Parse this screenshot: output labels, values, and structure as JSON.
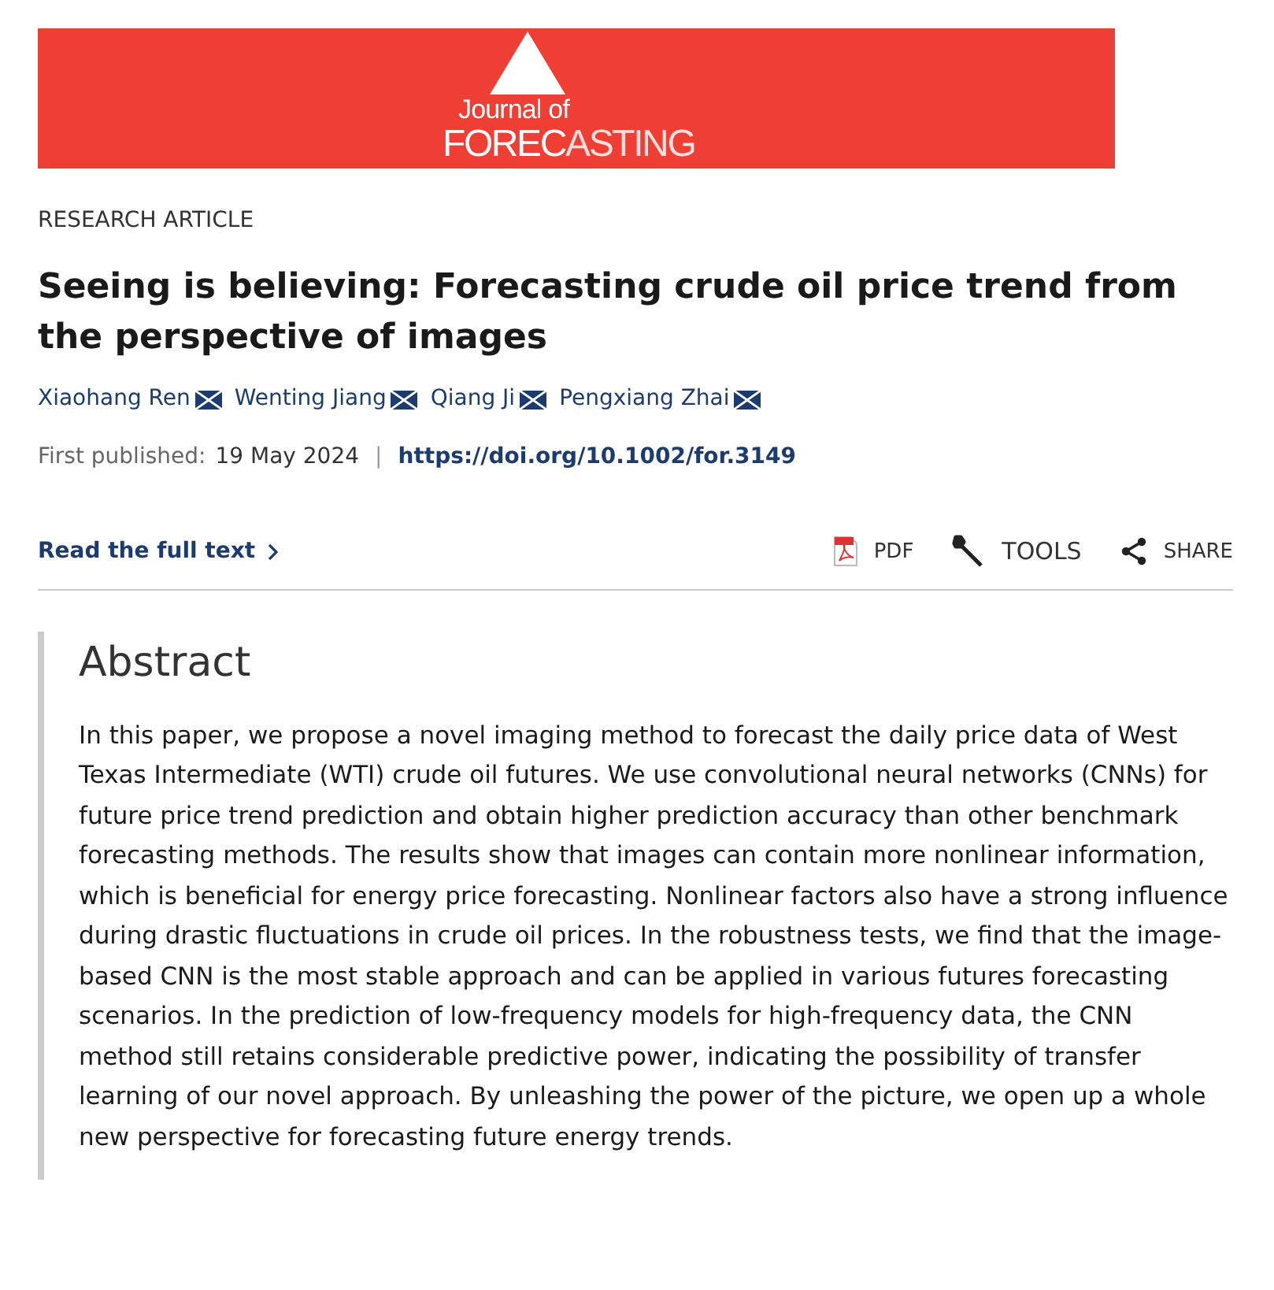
{
  "banner": {
    "logo_line_1": "Journal of",
    "logo_line_2a": "FOREC",
    "logo_line_2b": "ASTING"
  },
  "article_type": "RESEARCH ARTICLE",
  "title": "Seeing is believing: Forecasting crude oil price trend from the perspective of images",
  "authors": [
    {
      "name": "Xiaohang Ren"
    },
    {
      "name": "Wenting Jiang"
    },
    {
      "name": "Qiang Ji"
    },
    {
      "name": "Pengxiang Zhai"
    }
  ],
  "published_label": "First published:",
  "published_date": "19 May 2024",
  "separator": "|",
  "doi": "https://doi.org/10.1002/for.3149",
  "read_full_text": "Read the full text",
  "tools": [
    {
      "kind": "pdf",
      "label": "PDF"
    },
    {
      "kind": "tools",
      "label": "TOOLS"
    },
    {
      "kind": "share",
      "label": "SHARE"
    }
  ],
  "abstract": {
    "heading": "Abstract",
    "text": "In this paper, we propose a novel imaging method to forecast the daily price data of West Texas Intermediate (WTI) crude oil futures. We use convolutional neural networks (CNNs) for future price trend prediction and obtain higher prediction accuracy than other benchmark forecasting methods. The results show that images can contain more nonlinear information, which is beneficial for energy price forecasting. Nonlinear factors also have a strong influence during drastic fluctuations in crude oil prices. In the robustness tests, we find that the image-based CNN is the most stable approach and can be applied in various futures forecasting scenarios. In the prediction of low-frequency models for high-frequency data, the CNN method still retains considerable predictive power, indicating the possibility of transfer learning of our novel approach. By unleashing the power of the picture, we open up a whole new perspective for forecasting future energy trends."
  }
}
